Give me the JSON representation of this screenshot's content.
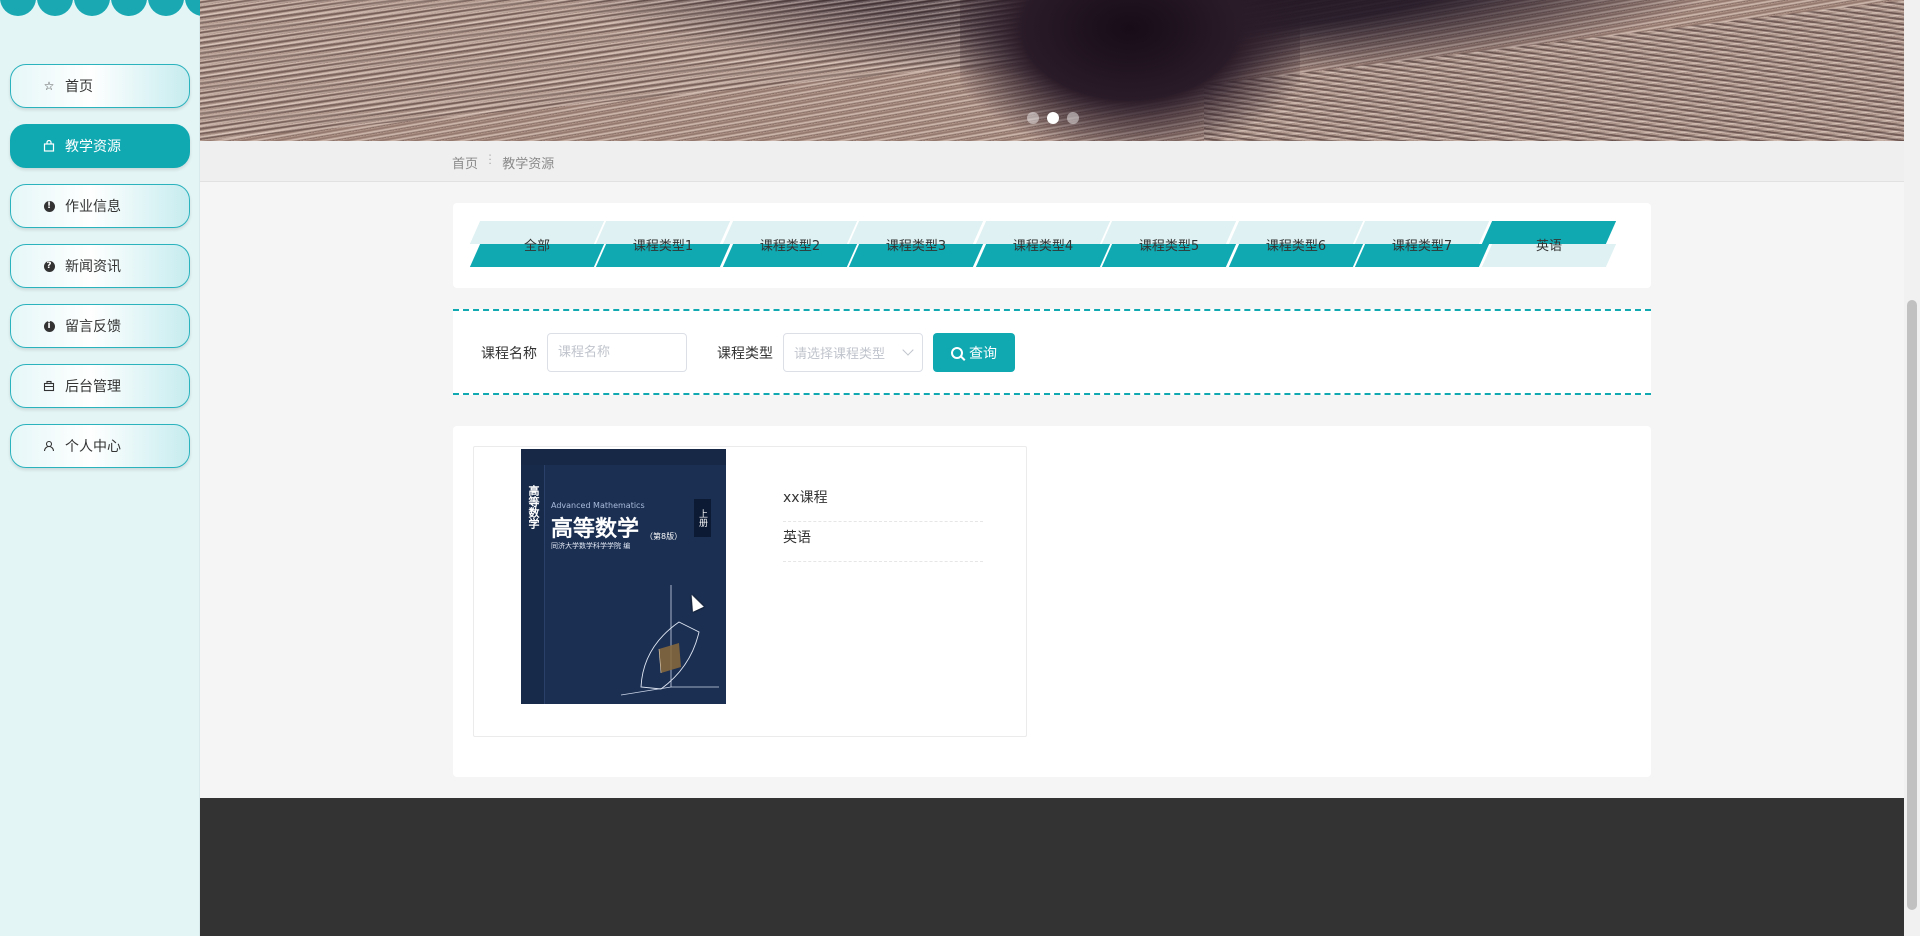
{
  "sidebar": {
    "items": [
      {
        "label": "首页",
        "icon": "star-icon"
      },
      {
        "label": "教学资源",
        "icon": "bag-icon"
      },
      {
        "label": "作业信息",
        "icon": "exclamation-icon"
      },
      {
        "label": "新闻资讯",
        "icon": "question-icon"
      },
      {
        "label": "留言反馈",
        "icon": "info-icon"
      },
      {
        "label": "后台管理",
        "icon": "briefcase-icon"
      },
      {
        "label": "个人中心",
        "icon": "user-icon"
      }
    ],
    "active_index": 1
  },
  "banner": {
    "slides": 3,
    "active_slide": 2
  },
  "breadcrumb": {
    "home": "首页",
    "separator": "ⵗ",
    "current": "教学资源"
  },
  "categories": {
    "items": [
      "全部",
      "课程类型1",
      "课程类型2",
      "课程类型3",
      "课程类型4",
      "课程类型5",
      "课程类型6",
      "课程类型7",
      "英语"
    ],
    "active": "英语"
  },
  "search": {
    "name_label": "课程名称",
    "name_placeholder": "课程名称",
    "type_label": "课程类型",
    "type_placeholder": "请选择课程类型",
    "button_label": "查询"
  },
  "course_card": {
    "name": "xx课程",
    "type": "英语",
    "cover": {
      "title": "高等数学",
      "edition": "（第8版）",
      "subtitle_en": "Advanced Mathematics",
      "volume": "上册",
      "publisher_line": "同济大学数学科学学院 编"
    }
  },
  "colors": {
    "accent": "#10a9b2",
    "sidebar_bg": "#e4f5f6",
    "footer_bg": "#333333"
  }
}
